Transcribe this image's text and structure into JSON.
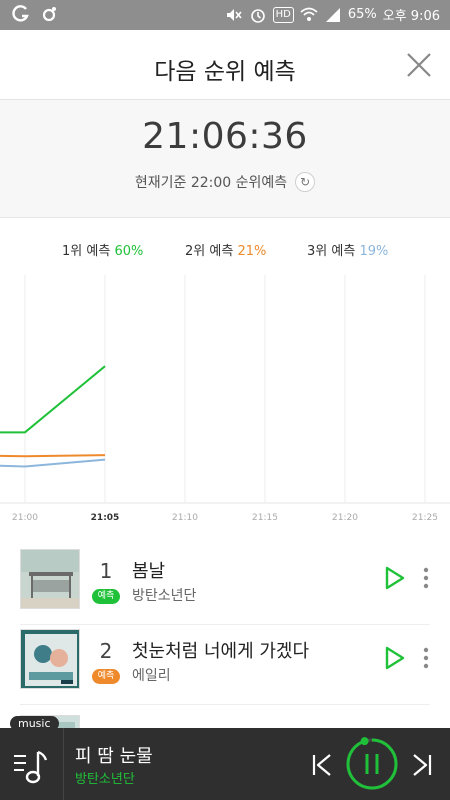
{
  "status_bar": {
    "icons": [
      "g-icon",
      "notification-dot-icon",
      "mute-icon",
      "alarm-icon",
      "hd-icon",
      "wifi-icon",
      "signal-icon"
    ],
    "hd_label": "HD",
    "battery": "65%",
    "time": "오후 9:06"
  },
  "header": {
    "title": "다음 순위 예측",
    "close_icon": "close-icon"
  },
  "countdown": {
    "time": "21:06:36",
    "basis": "현재기준 22:00 순위예측",
    "refresh_icon": "refresh-icon"
  },
  "legend": [
    {
      "label": "1위 예측",
      "pct": "60%",
      "color": "#1fc139"
    },
    {
      "label": "2위 예측",
      "pct": "21%",
      "color": "#ee8a2c"
    },
    {
      "label": "3위 예측",
      "pct": "19%",
      "color": "#8cb6dc"
    }
  ],
  "chart_data": {
    "type": "line",
    "x": [
      "20:55",
      "21:00",
      "21:05"
    ],
    "x_tick_labels": [
      "21:00",
      "21:05",
      "21:10",
      "21:15",
      "21:20",
      "21:25"
    ],
    "x_tick_minutes": [
      0,
      5,
      10,
      15,
      20,
      25
    ],
    "x_minutes": [
      -5,
      0,
      5
    ],
    "ylim": [
      0,
      100
    ],
    "series": [
      {
        "name": "1위 예측",
        "color": "#1fc139",
        "values": [
          31,
          31,
          60
        ]
      },
      {
        "name": "2위 예측",
        "color": "#ee8a2c",
        "values": [
          21,
          20.5,
          21
        ]
      },
      {
        "name": "3위 예측",
        "color": "#8cb6dc",
        "values": [
          17,
          16,
          19
        ]
      }
    ],
    "grid": "vertical",
    "highlight_tick": "21:05"
  },
  "songs": [
    {
      "rank": "1",
      "badge": "예측",
      "badge_color": "#1fc139",
      "title": "봄날",
      "artist": "방탄소년단",
      "art": "bus-stop-album-art"
    },
    {
      "rank": "2",
      "badge": "예측",
      "badge_color": "#ee8a2c",
      "title": "첫눈처럼 너에게 가겠다",
      "artist": "에일리",
      "art": "drama-ost-album-art"
    },
    {
      "rank": "3",
      "title": "",
      "artist": "",
      "art": "third-album-art"
    }
  ],
  "player": {
    "tag": "music",
    "title": "피 땀 눈물",
    "artist": "방탄소년단",
    "playlist_icon": "music-note-list-icon",
    "prev_icon": "skip-previous-icon",
    "pause_icon": "pause-icon",
    "next_icon": "skip-next-icon",
    "progress": 0.95
  }
}
